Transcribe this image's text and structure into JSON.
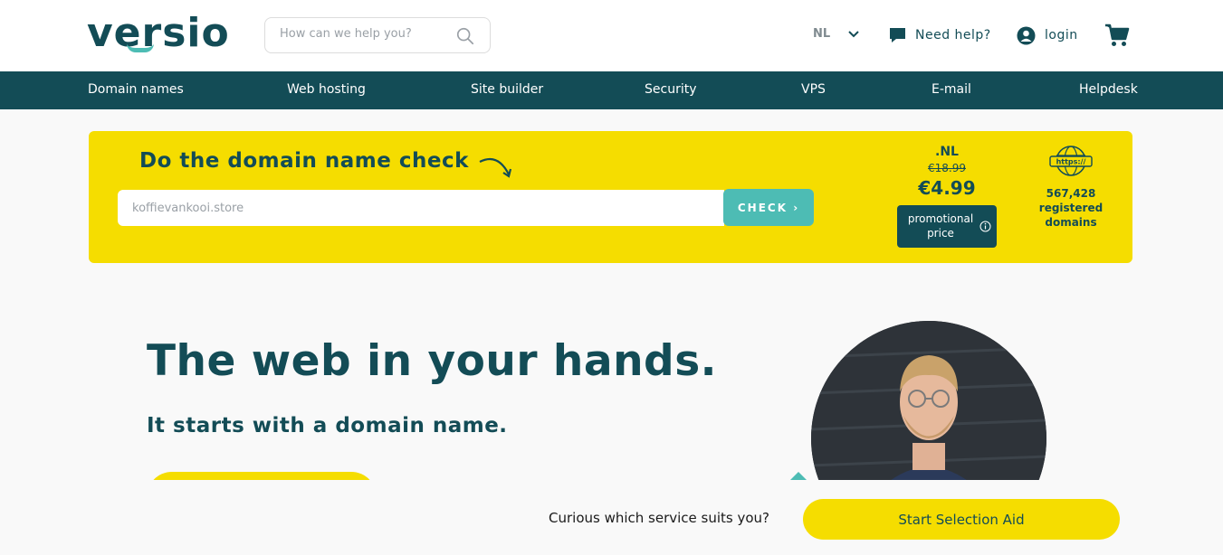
{
  "header": {
    "logo_text": "versio",
    "search_placeholder": "How can we help you?",
    "language": "NL",
    "help_label": "Need help?",
    "login_label": "login"
  },
  "nav": {
    "items": [
      "Domain names",
      "Web hosting",
      "Site builder",
      "Security",
      "VPS",
      "E-mail",
      "Helpdesk"
    ]
  },
  "domain_check": {
    "title": "Do the domain name check",
    "input_value": "koffievankooi.store",
    "button_label": "CHECK ›",
    "tld": ".NL",
    "old_price": "€18.99",
    "price": "€4.99",
    "promo_label": "promotional price",
    "registered_count": "567,428",
    "registered_label": "registered domains",
    "globe_label": "https://"
  },
  "hero": {
    "title": "The web in your hands.",
    "subtitle": "It starts with a domain name."
  },
  "bottom": {
    "question": "Curious which service suits you?",
    "button_label": "Start Selection Aid"
  },
  "colors": {
    "primary": "#134c56",
    "accent": "#4dbcb4",
    "yellow": "#f5dd00"
  },
  "icons": [
    "search-icon",
    "chevron-down-icon",
    "chat-icon",
    "user-icon",
    "cart-icon",
    "arrow-icon",
    "info-icon",
    "globe-icon"
  ]
}
